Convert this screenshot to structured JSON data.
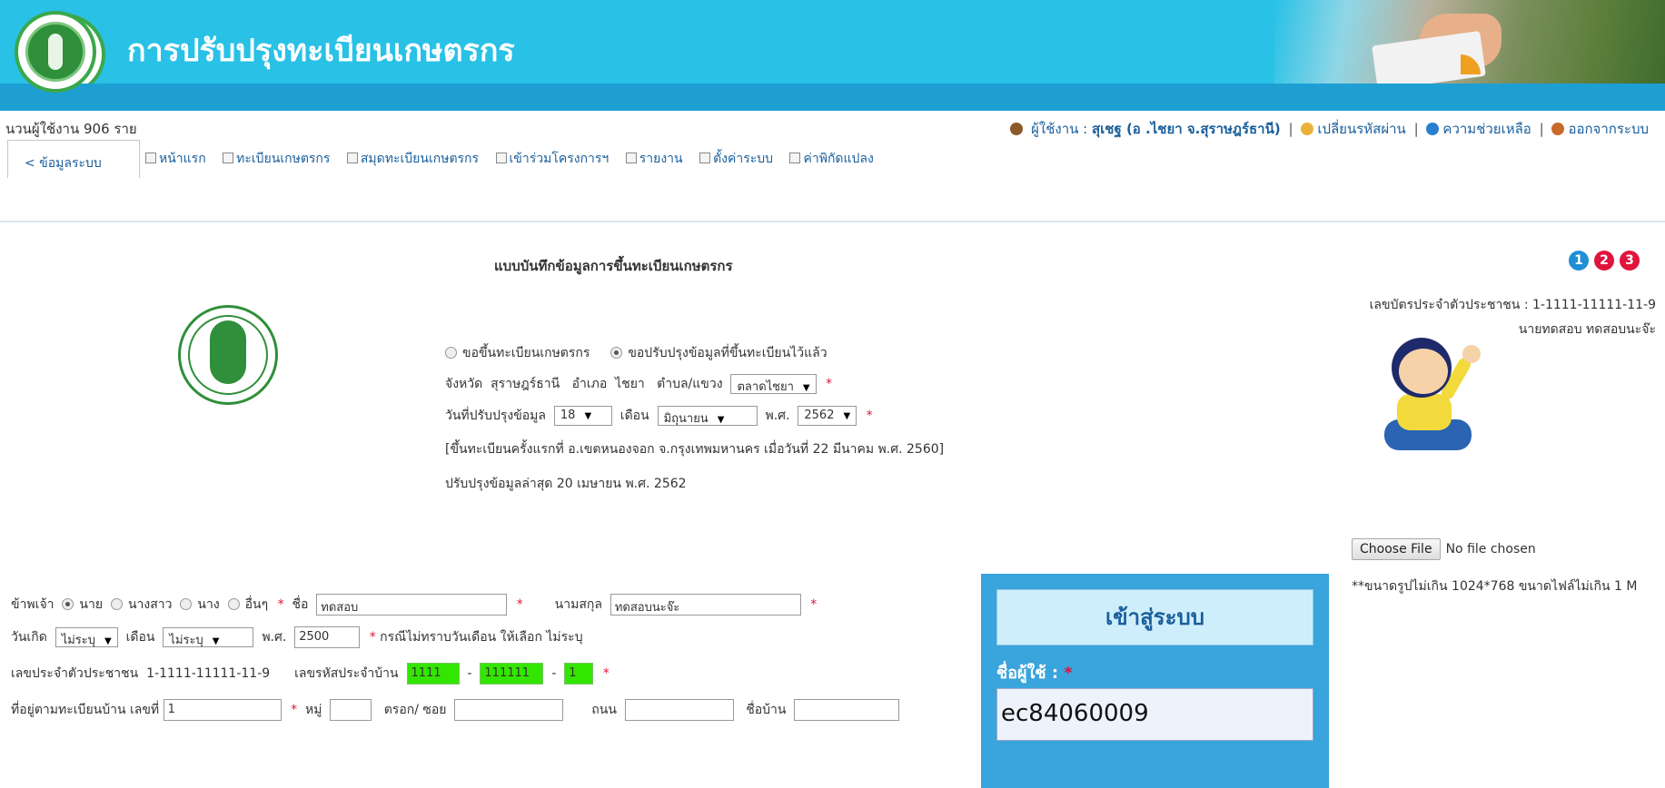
{
  "header": {
    "title": "การปรับปรุงทะเบียนเกษตรกร"
  },
  "infobar": {
    "user_count": "นวนผู้ใช้งาน 906 ราย",
    "user_label": "ผู้ใช้งาน :",
    "user_name": "สุเชฐ (อ .ไชยา จ.สุราษฎร์ธานี)",
    "change_password": "เปลี่ยนรหัสผ่าน",
    "help": "ความช่วยเหลือ",
    "logout": "ออกจากระบบ"
  },
  "nav": {
    "system_tab": "< ข้อมูลระบบ",
    "items": [
      "หน้าแรก",
      "ทะเบียนเกษตรกร",
      "สมุดทะเบียนเกษตรกร",
      "เข้าร่วมโครงการฯ",
      "รายงาน",
      "ตั้งค่าระบบ",
      "ค่าพิกัดแปลง"
    ]
  },
  "form": {
    "title": "แบบบันทึกข้อมูลการขึ้นทะเบียนเกษตรกร",
    "steps": [
      "1",
      "2",
      "3"
    ],
    "step_colors": [
      "#1f8fd6",
      "#e0143c",
      "#e0143c"
    ],
    "reg_options": [
      "ขอขึ้นทะเบียนเกษตรกร",
      "ขอปรับปรุงข้อมูลที่ขึ้นทะเบียนไว้แล้ว"
    ],
    "location": {
      "province_label": "จังหวัด",
      "province": "สุราษฎร์ธานี",
      "district_label": "อำเภอ",
      "district": "ไชยา",
      "subdistrict_label": "ตำบล/แขวง",
      "subdistrict": "ตลาดไชยา"
    },
    "update_date": {
      "label": "วันที่ปรับปรุงข้อมูล",
      "day": "18",
      "month_label": "เดือน",
      "month": "มิถุนายน",
      "year_label": "พ.ศ.",
      "year": "2562"
    },
    "first_registration": "[ขึ้นทะเบียนครั้งแรกที่ อ.เขตหนองจอก จ.กรุงเทพมหานคร เมื่อวันที่ 22 มีนาคม พ.ศ. 2560]",
    "last_update": "ปรับปรุงข้อมูลล่าสุด 20 เมษายน พ.ศ. 2562",
    "person": {
      "prefix_label": "ข้าพเจ้า",
      "prefixes": [
        "นาย",
        "นางสาว",
        "นาง",
        "อื่นๆ"
      ],
      "first_name_label": "ชื่อ",
      "first_name": "ทดสอบ",
      "last_name_label": "นามสกุล",
      "last_name": "ทดสอบนะจ๊ะ"
    },
    "birth": {
      "label": "วันเกิด",
      "day": "ไม่ระบุ",
      "month_label": "เดือน",
      "month": "ไม่ระบุ",
      "year_label": "พ.ศ.",
      "year": "2500",
      "note": "กรณีไม่ทราบวันเดือน ให้เลือก ไม่ระบุ"
    },
    "ids": {
      "citizen_label": "เลขประจำตัวประชาชน",
      "citizen": "1-1111-11111-11-9",
      "house_code_label": "เลขรหัสประจำบ้าน",
      "house_code": [
        "1111",
        "111111",
        "1"
      ],
      "dash": "-"
    },
    "address": {
      "label": "ที่อยู่ตามทะเบียนบ้าน เลขที่",
      "house_no": "1",
      "moo_label": "หมู่",
      "moo": "",
      "soi_label": "ตรอก/ ซอย",
      "soi": "",
      "road_label": "ถนน",
      "road": "",
      "village_label": "ชื่อบ้าน",
      "village": ""
    },
    "required_mark": "*"
  },
  "profile": {
    "id_line": "เลขบัตรประจำตัวประชาชน : 1-1111-11111-11-9",
    "name": "นายทดสอบ ทดสอบนะจ๊ะ",
    "choose_file": "Choose File",
    "no_file": "No file chosen",
    "size_note": "**ขนาดรูปไม่เกิน 1024*768 ขนาดไฟล์ไม่เกิน 1 M"
  },
  "login": {
    "title": "เข้าสู่ระบบ",
    "username_label": "ชื่อผู้ใช้ :",
    "username": "ec84060009",
    "required_mark": "*"
  }
}
